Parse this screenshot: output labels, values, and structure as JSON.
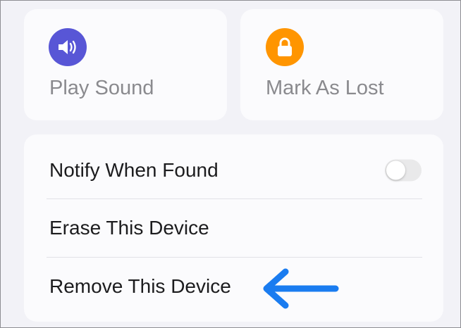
{
  "actions": [
    {
      "label": "Play Sound",
      "icon": "speaker-icon",
      "color": "#5856d6"
    },
    {
      "label": "Mark As Lost",
      "icon": "lock-icon",
      "color": "#ff9500"
    }
  ],
  "settings": {
    "notify_label": "Notify When Found",
    "notify_enabled": false,
    "erase_label": "Erase This Device",
    "remove_label": "Remove This Device"
  },
  "annotation": {
    "icon": "arrow-left-icon",
    "color": "#1a7cf0"
  },
  "colors": {
    "background": "#f2f2f7",
    "card": "#fbfbfd",
    "text": "#1c1c1e",
    "secondary_text": "#8a8a8e"
  }
}
